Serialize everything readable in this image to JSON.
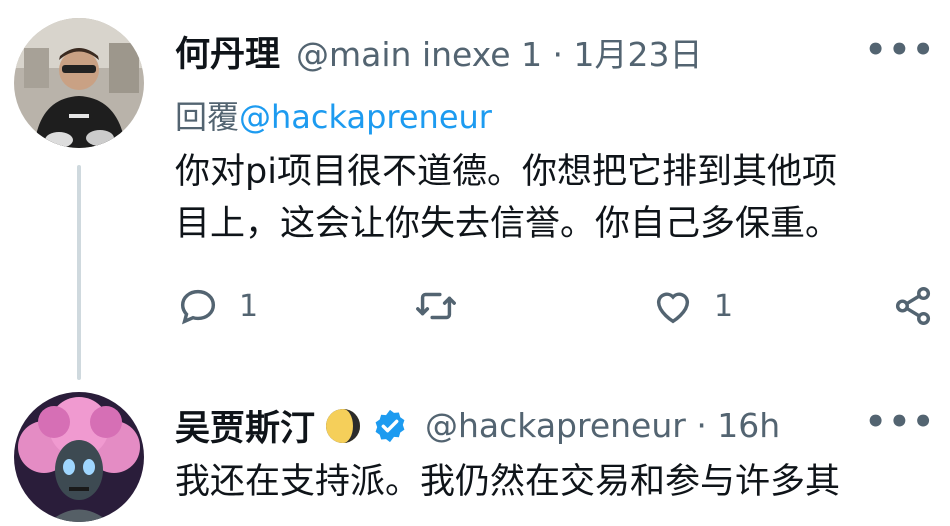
{
  "tweet1": {
    "name": "何丹理",
    "handle_time": "@main inexe 1 · 1月23日",
    "reply_label": "回覆",
    "reply_handle": "@hackapreneur",
    "body_line1": "你对pi项目很不道德。你想把它排到其他项",
    "body_line2": "目上，这会让你失去信誉。你自己多保重。",
    "reply_count": "1",
    "like_count": "1"
  },
  "tweet2": {
    "name": "吴贾斯汀",
    "handle_time": "@hackapreneur · 16h",
    "body_line1": "我还在支持派。我仍然在交易和参与许多其"
  },
  "more_glyph": "•••",
  "colors": {
    "link": "#1d9bf0",
    "secondary": "#536471",
    "thread_line": "#cfd9de",
    "verified": "#1d9bf0"
  },
  "icons": [
    "reply-icon",
    "retweet-icon",
    "like-icon",
    "share-icon",
    "more-icon",
    "verified-icon",
    "moon-icon"
  ]
}
